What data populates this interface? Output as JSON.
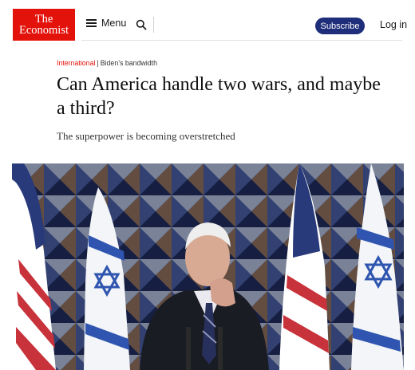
{
  "header": {
    "logo_line1": "The",
    "logo_line2": "Economist",
    "menu_label": "Menu",
    "subscribe_label": "Subscribe",
    "login_label": "Log in"
  },
  "article": {
    "section": "International",
    "separator": "|",
    "series": "Biden’s bandwidth",
    "headline": "Can America handle two wars, and maybe a third?",
    "standfirst": "The superpower is becoming overstretched"
  },
  "colors": {
    "brand_red": "#e3120b",
    "subscribe_bg": "#1f2e7a"
  },
  "icons": {
    "menu": "hamburger-icon",
    "search": "search-icon"
  }
}
